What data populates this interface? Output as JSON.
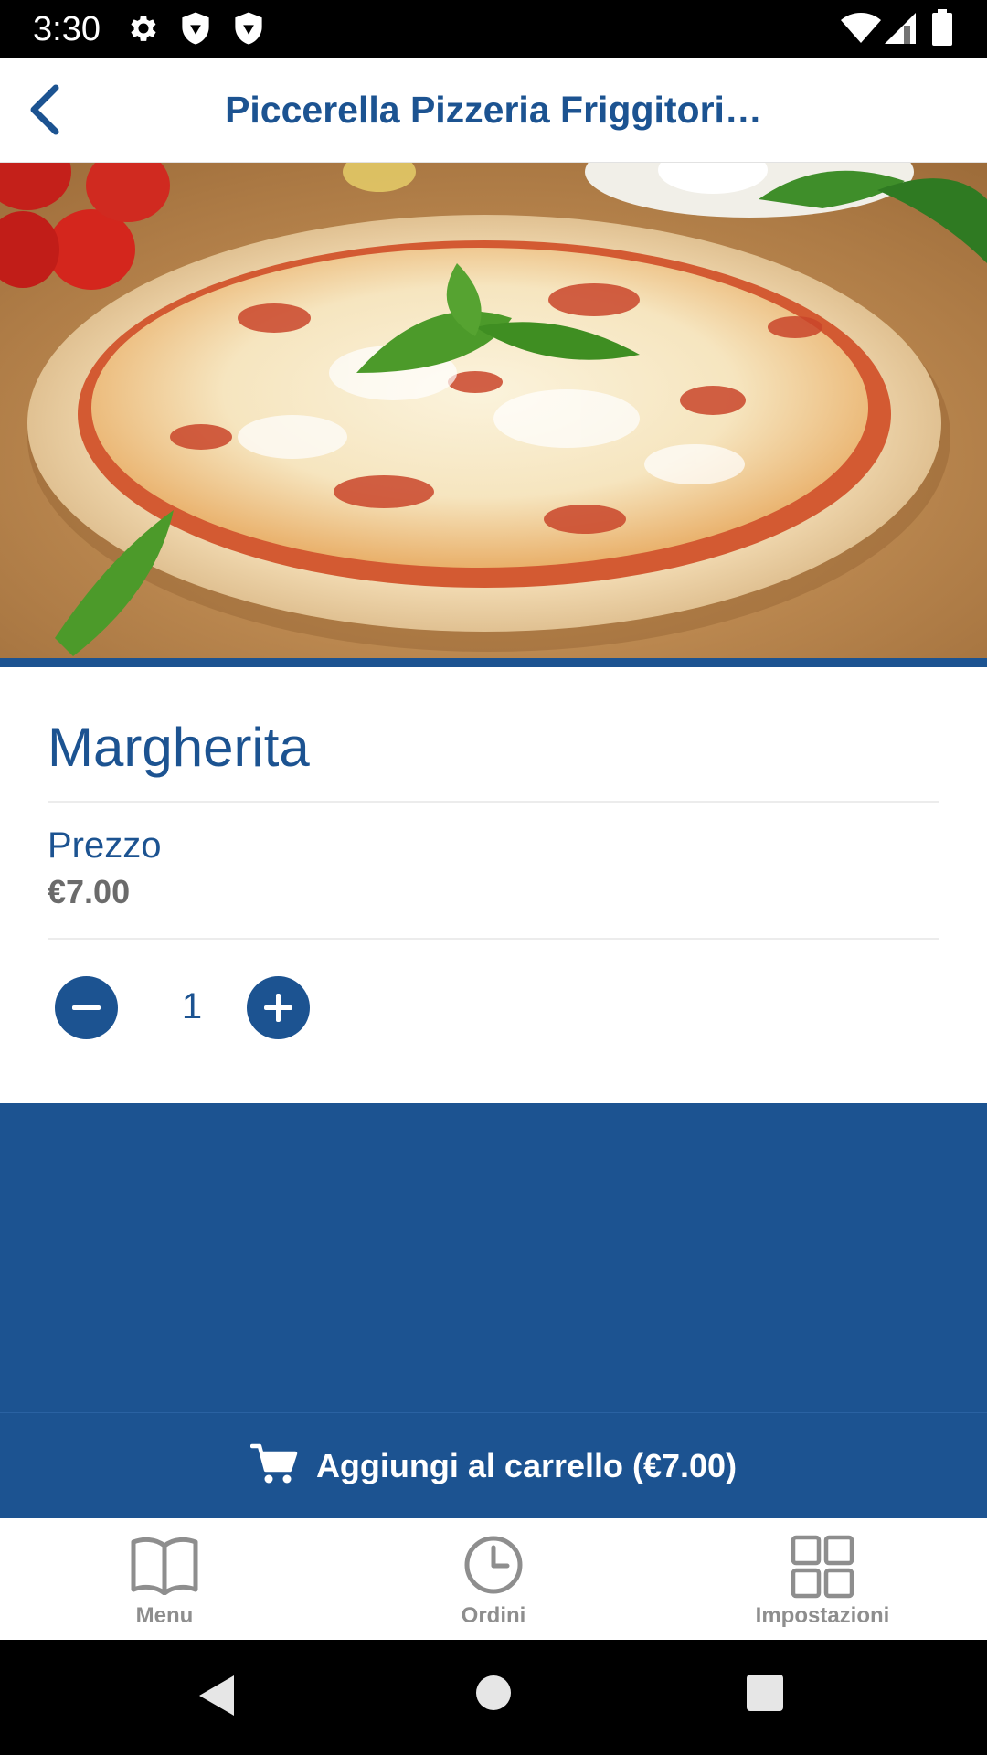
{
  "status_bar": {
    "time": "3:30",
    "left_icons": [
      "gear-icon",
      "shield-icon",
      "shield-icon"
    ],
    "right_icons": [
      "wifi-icon",
      "signal-icon",
      "battery-icon"
    ]
  },
  "header": {
    "title": "Piccerella Pizzeria Friggitori…",
    "back_icon": "chevron-left-icon"
  },
  "product": {
    "name": "Margherita",
    "price_label": "Prezzo",
    "price_value": "€7.00",
    "quantity": "1"
  },
  "cart_button": {
    "label": "Aggiungi al carrello (€7.00)",
    "icon": "cart-icon"
  },
  "bottom_nav": {
    "items": [
      {
        "label": "Menu",
        "icon": "book-icon"
      },
      {
        "label": "Ordini",
        "icon": "clock-icon"
      },
      {
        "label": "Impostazioni",
        "icon": "grid-icon"
      }
    ]
  },
  "colors": {
    "brand": "#1c5391",
    "nav_inactive": "#8e8e8e",
    "price_text": "#6b6b6b"
  }
}
